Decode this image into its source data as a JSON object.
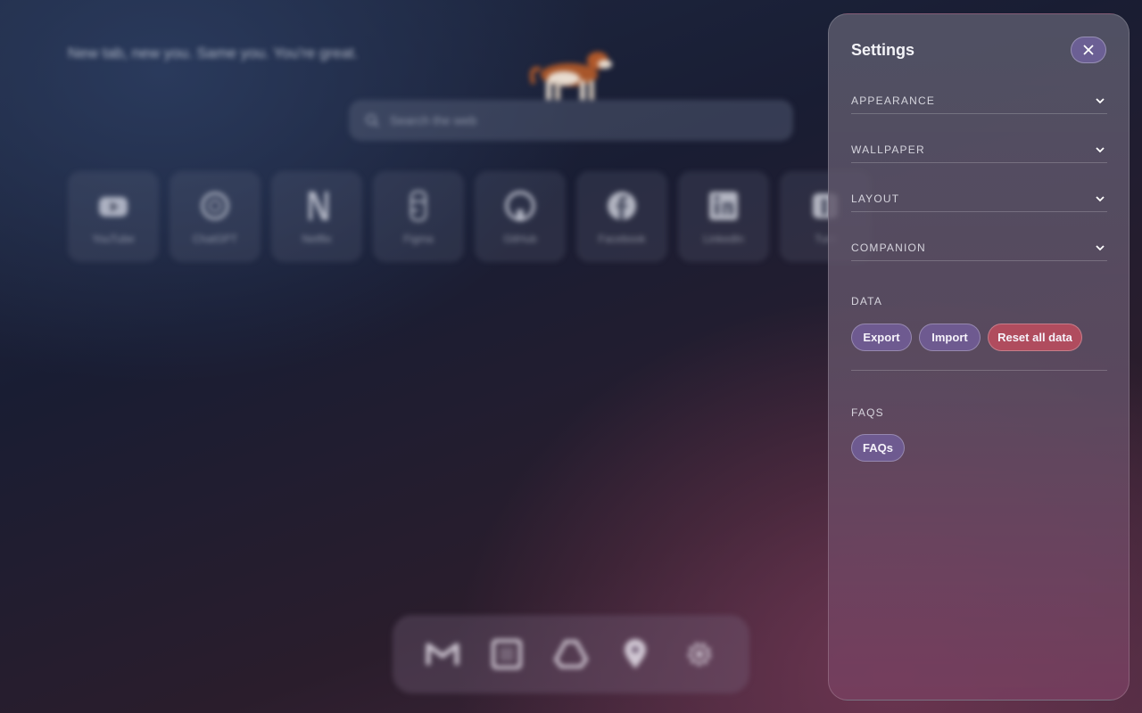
{
  "background": {
    "tagline": "New tab, new you. Same you. You're great.",
    "search": {
      "placeholder": "Search the web"
    },
    "shortcuts": [
      {
        "label": "YouTube",
        "icon": "youtube-icon"
      },
      {
        "label": "ChatGPT",
        "icon": "chatgpt-icon"
      },
      {
        "label": "Netflix",
        "icon": "netflix-icon"
      },
      {
        "label": "Figma",
        "icon": "figma-icon"
      },
      {
        "label": "GitHub",
        "icon": "github-icon"
      },
      {
        "label": "Facebook",
        "icon": "facebook-icon"
      },
      {
        "label": "LinkedIn",
        "icon": "linkedin-icon"
      },
      {
        "label": "Tum",
        "icon": "tumblr-icon"
      }
    ],
    "dock": [
      "gmail-icon",
      "notion-icon",
      "drive-icon",
      "maps-icon",
      "settings-icon"
    ]
  },
  "settings": {
    "title": "Settings",
    "sections": [
      {
        "label": "APPEARANCE"
      },
      {
        "label": "WALLPAPER"
      },
      {
        "label": "LAYOUT"
      },
      {
        "label": "COMPANION"
      }
    ],
    "data": {
      "heading": "DATA",
      "export_label": "Export",
      "import_label": "Import",
      "reset_label": "Reset all data"
    },
    "faqs": {
      "heading": "FAQS",
      "button_label": "FAQs"
    }
  },
  "colors": {
    "accent_purple": "#6e5a90",
    "danger_red": "#b04c5e"
  }
}
